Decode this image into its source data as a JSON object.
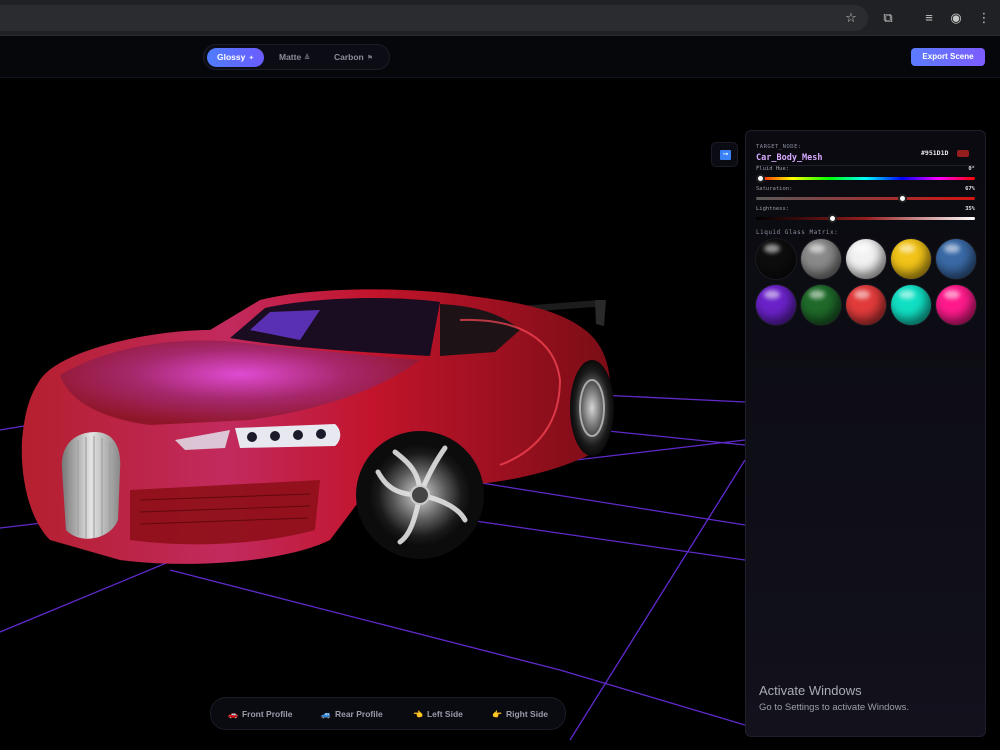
{
  "toolbar": {
    "materials": [
      {
        "label": "Glossy",
        "glyph": "✦",
        "active": true
      },
      {
        "label": "Matte",
        "glyph": "≜",
        "active": false
      },
      {
        "label": "Carbon",
        "glyph": "⚑",
        "active": false
      }
    ],
    "export_label": "Export Scene"
  },
  "panel": {
    "target_label": "TARGET_NODE:",
    "node_name": "Car_Body_Mesh",
    "hex": "#951D1D",
    "sliders": [
      {
        "label": "Fluid Hue:",
        "value": "0°",
        "fraction": 0.02
      },
      {
        "label": "Saturation:",
        "value": "67%",
        "fraction": 0.67
      },
      {
        "label": "Lightness:",
        "value": "35%",
        "fraction": 0.35
      }
    ],
    "matrix_label": "Liquid Glass Matrix:",
    "swatches": [
      "#0d0d0d",
      "#8a8a8a",
      "#f2f2f2",
      "#f2c318",
      "#3a6aa6",
      "#6a22c9",
      "#1f6a2a",
      "#e23b3b",
      "#11e0c4",
      "#ff1a8c"
    ]
  },
  "camera": [
    {
      "label": "Front Profile",
      "emoji": "🚗"
    },
    {
      "label": "Rear Profile",
      "emoji": "🚙"
    },
    {
      "label": "Left Side",
      "emoji": "👈"
    },
    {
      "label": "Right Side",
      "emoji": "👉"
    }
  ],
  "watermark": {
    "title": "Activate Windows",
    "sub": "Go to Settings to activate Windows."
  },
  "colors": {
    "accent": "#4f7cff",
    "body": "#951D1D",
    "grid": "#7a2cff"
  }
}
